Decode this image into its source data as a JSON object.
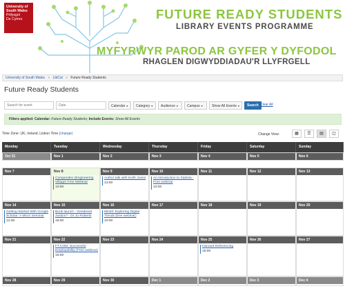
{
  "banner": {
    "logo_line1": "University of",
    "logo_line2": "South Wales",
    "logo_line3": "Prifysgol",
    "logo_line4": "De Cymru",
    "title_en": "FUTURE READY STUDENTS",
    "subtitle_en": "LIBRARY EVENTS PROGRAMME",
    "title_cy": "MYFYRWYR PAROD AR GYFER Y DYFODOL",
    "subtitle_cy": "RHAGLEN DIGWYDDIADAU'R LLYFRGELL",
    "green": "#8cc63f",
    "red": "#b5121b"
  },
  "breadcrumb": [
    "University of South Wales",
    "LibCal",
    "Future Ready Students"
  ],
  "page_title": "Future Ready Students",
  "filters": {
    "search_placeholder": "Search for event",
    "date_placeholder": "Date",
    "calendar": "Calendar",
    "category": "Category",
    "audience": "Audience",
    "campus": "Campus",
    "show_all": "Show All Events",
    "search_btn": "Search",
    "clear_all": "Clear All"
  },
  "applied": {
    "prefix": "Filters applied:",
    "cal_label": "Calendar:",
    "cal_value": "Future Ready Students;",
    "inc_label": "Include Events:",
    "inc_value": "Show All Events"
  },
  "timezone": {
    "text": "Time Zone: UK, Ireland, Lisbon Time",
    "change": "(change)"
  },
  "change_view": "Change View:",
  "weekdays": [
    "Monday",
    "Tuesday",
    "Wednesday",
    "Thursday",
    "Friday",
    "Saturday",
    "Sunday"
  ],
  "weeks": [
    [
      {
        "label": "Oct 31",
        "other": true
      },
      {
        "label": "Nov 1"
      },
      {
        "label": "Nov 2"
      },
      {
        "label": "Nov 3"
      },
      {
        "label": "Nov 4"
      },
      {
        "label": "Nov 5"
      },
      {
        "label": "Nov 6"
      }
    ],
    [
      {
        "label": "Nov 7"
      },
      {
        "label": "Nov 8",
        "today": true,
        "events": [
          {
            "title": "Compendex (Engineering Village) Free Webinar",
            "time": "10:00"
          }
        ]
      },
      {
        "label": "Nov 9",
        "events": [
          {
            "title": "Author talk with Keith Jones",
            "time": "13:00"
          }
        ]
      },
      {
        "label": "Nov 10",
        "events": [
          {
            "title": "An introduction to Statista - Free webinar",
            "time": "10:00"
          }
        ]
      },
      {
        "label": "Nov 11"
      },
      {
        "label": "Nov 12"
      },
      {
        "label": "Nov 13"
      }
    ],
    [
      {
        "label": "Nov 14",
        "events": [
          {
            "title": "Getting Started With Google Scholar: A Micro Seminar",
            "time": "12:30"
          }
        ]
      },
      {
        "label": "Nov 15",
        "events": [
          {
            "title": "Book launch - Gendered Justice? - Dr Jo Roberts",
            "time": "18:00"
          }
        ]
      },
      {
        "label": "Nov 16",
        "events": [
          {
            "title": "Mintel: Exploring Digital Trends (free webinar)",
            "time": "10:00"
          }
        ]
      },
      {
        "label": "Nov 17"
      },
      {
        "label": "Nov 18"
      },
      {
        "label": "Nov 19"
      },
      {
        "label": "Nov 20"
      }
    ],
    [
      {
        "label": "Nov 21"
      },
      {
        "label": "Nov 22",
        "events": [
          {
            "title": "FT.COM: Successful Employability (Free webinar)",
            "time": "16:00"
          }
        ]
      },
      {
        "label": "Nov 23"
      },
      {
        "label": "Nov 24"
      },
      {
        "label": "Nov 25",
        "events": [
          {
            "title": "Harvard Referencing",
            "time": "15:00"
          }
        ]
      },
      {
        "label": "Nov 26"
      },
      {
        "label": "Nov 27"
      }
    ],
    [
      {
        "label": "Nov 28"
      },
      {
        "label": "Nov 29"
      },
      {
        "label": "Nov 30"
      },
      {
        "label": "Dec 1",
        "other": true
      },
      {
        "label": "Dec 2",
        "other": true
      },
      {
        "label": "Dec 3",
        "other": true
      },
      {
        "label": "Dec 4",
        "other": true
      }
    ]
  ]
}
